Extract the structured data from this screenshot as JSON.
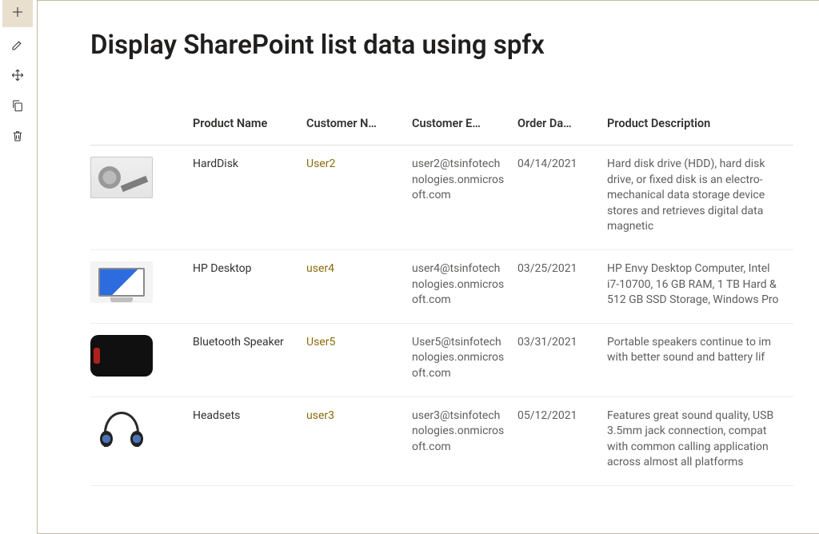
{
  "header": {
    "title": "Display SharePoint list data using spfx"
  },
  "toolbar_icons": {
    "add": "plus-icon",
    "edit": "edit-icon",
    "move": "move-icon",
    "copy": "copy-icon",
    "delete": "trash-icon"
  },
  "table": {
    "columns": {
      "image": "",
      "product_name": "Product Name",
      "customer_name": "Customer N…",
      "customer_email": "Customer E…",
      "order_date": "Order Da…",
      "product_description": "Product Description"
    },
    "rows": [
      {
        "image": "harddisk",
        "product_name": "HardDisk",
        "customer_name": "User2",
        "customer_email": "user2@tsinfotechnologies.onmicrosoft.com",
        "order_date": "04/14/2021",
        "product_description": "Hard disk drive (HDD), hard disk drive, or fixed disk is an electro-mechanical data storage device stores and retrieves digital data magnetic"
      },
      {
        "image": "desktop",
        "product_name": "HP Desktop",
        "customer_name": "user4",
        "customer_email": "user4@tsinfotechnologies.onmicrosoft.com",
        "order_date": "03/25/2021",
        "product_description": "HP Envy Desktop Computer, Intel i7-10700, 16 GB RAM, 1 TB Hard & 512 GB SSD Storage, Windows Pro"
      },
      {
        "image": "speaker",
        "product_name": "Bluetooth Speaker",
        "customer_name": "User5",
        "customer_email": "User5@tsinfotechnologies.onmicrosoft.com",
        "order_date": "03/31/2021",
        "product_description": "Portable speakers continue to im with better sound and battery lif"
      },
      {
        "image": "headset",
        "product_name": "Headsets",
        "customer_name": "user3",
        "customer_email": "user3@tsinfotechnologies.onmicrosoft.com",
        "order_date": "05/12/2021",
        "product_description": "Features great sound quality, USB 3.5mm jack connection, compat with common calling application across almost all platforms"
      }
    ]
  }
}
